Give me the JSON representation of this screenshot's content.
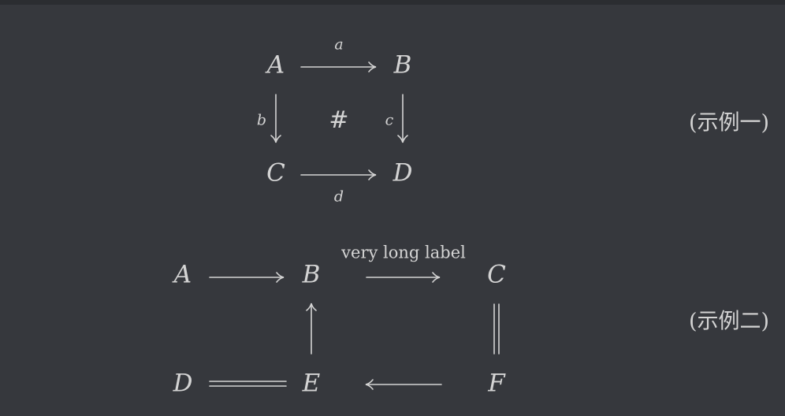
{
  "example1": {
    "nodes": {
      "A": "A",
      "B": "B",
      "C": "C",
      "D": "D"
    },
    "labels": {
      "top": "a",
      "left": "b",
      "right": "c",
      "bottom": "d"
    },
    "center": "#",
    "tag": "(示例一)"
  },
  "example2": {
    "nodes": {
      "A": "A",
      "B": "B",
      "C": "C",
      "D": "D",
      "E": "E",
      "F": "F"
    },
    "labels": {
      "bc": "very long label"
    },
    "tag": "(示例二)"
  }
}
